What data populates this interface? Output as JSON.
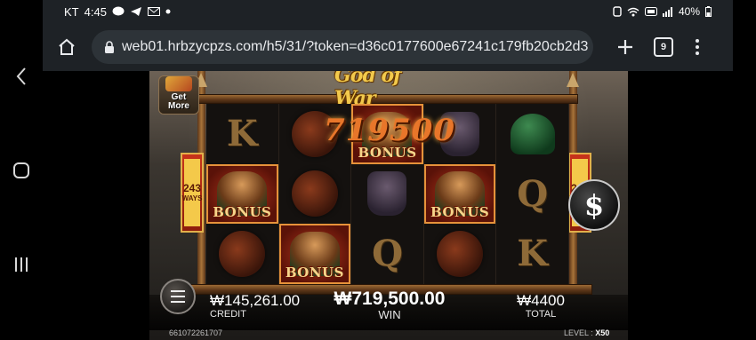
{
  "status_bar": {
    "carrier": "KT",
    "time": "4:45",
    "battery": "40%",
    "icons": [
      "chat-bubble-icon",
      "telegram-icon",
      "mail-icon",
      "dot-icon",
      "nfc-icon",
      "wifi-icon",
      "hd-icon",
      "signal-icon",
      "battery-icon"
    ]
  },
  "browser": {
    "url": "web01.hrbzycpzs.com/h5/31/?token=d36c0177600e67241c179fb20cb2d3",
    "tab_count": "9"
  },
  "game": {
    "logo": "God of War",
    "get_more": "Get\nMore",
    "ways_number": "243",
    "ways_label": "WAYS",
    "big_win_amount": "719500",
    "bonus_label": "BONUS",
    "coin_symbol": "$",
    "reels": [
      [
        "K",
        "horse",
        "bonus-warrior",
        "armor",
        "helmet"
      ],
      [
        "bonus-warrior",
        "horse",
        "armor",
        "bonus-warrior",
        "Q"
      ],
      [
        "horse",
        "bonus-warrior",
        "Q",
        "horse",
        "K"
      ]
    ],
    "credit_value": "₩145,261.00",
    "credit_label": "CREDIT",
    "win_value": "₩719,500.00",
    "win_label": "WIN",
    "total_value": "₩4400",
    "total_label": "TOTAL",
    "game_id": "661072261707",
    "level_label": "LEVEL :",
    "level_value": "X50"
  }
}
